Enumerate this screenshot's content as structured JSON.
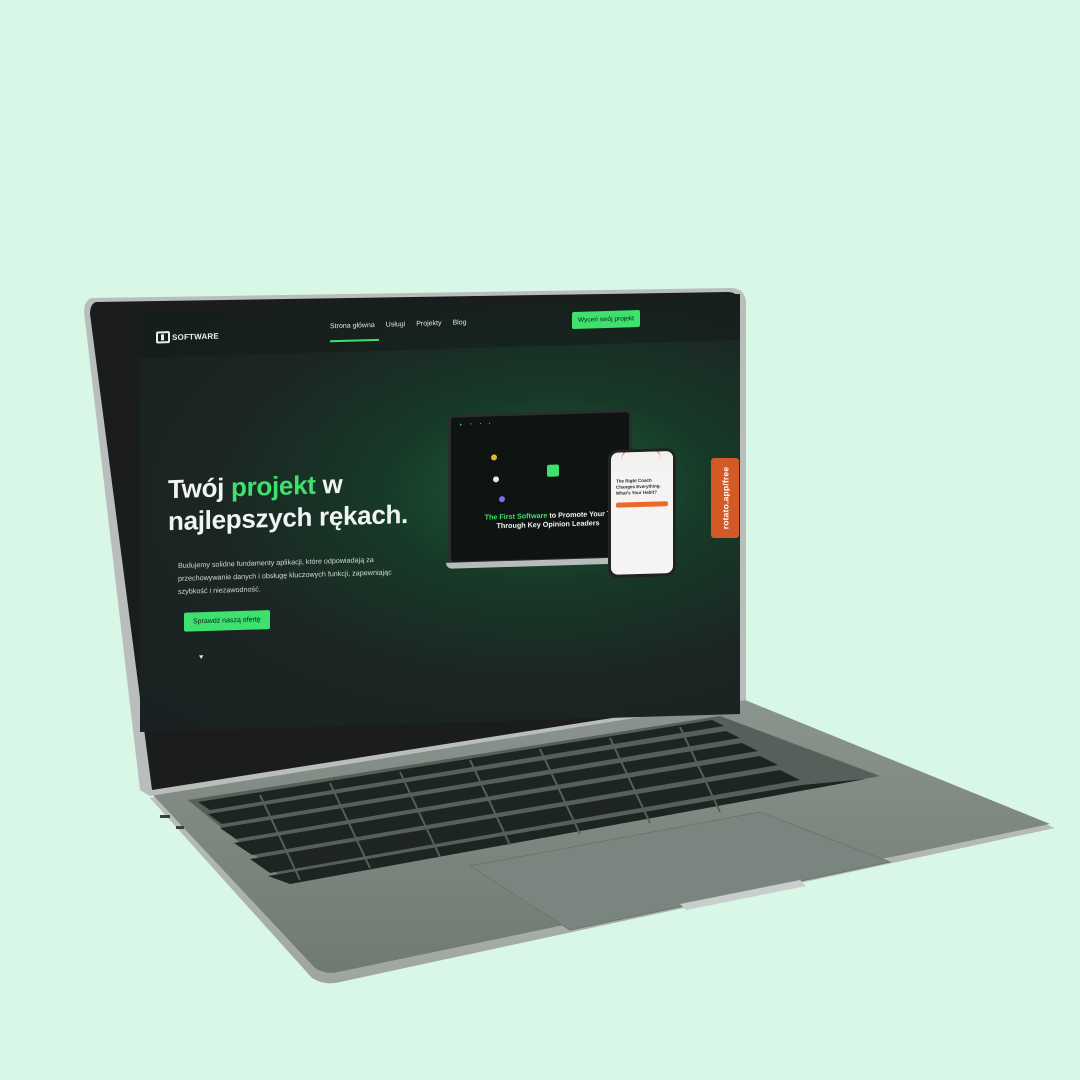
{
  "site": {
    "logo_text": "SOFTWARE",
    "nav": [
      "Strona główna",
      "Usługi",
      "Projekty",
      "Blog"
    ],
    "cta_top": "Wyceń swój projekt",
    "hero": {
      "title_part1": "Twój ",
      "title_accent": "projekt",
      "title_part2": " w",
      "title_line2": "najlepszych rękach.",
      "description": "Budujemy solidne fundamenty aplikacji, które odpowiadają za przechowywanie  danych i obsługę kluczowych funkcji, zapewniając szybkość i niezawodność.",
      "cta": "Sprawdź naszą ofertę"
    },
    "mockup": {
      "headline_accent": "The First Software",
      "headline_rest": " to Promote Your T",
      "headline_line2": "Through Key Opinion Leaders",
      "phone_title": "The Right Coach Changes Everything. What's Your Habit?"
    }
  },
  "side_tab": "rotato.app/free",
  "colors": {
    "background": "#d8f7e6",
    "accent": "#3ee06e",
    "tab": "#d35a26"
  }
}
